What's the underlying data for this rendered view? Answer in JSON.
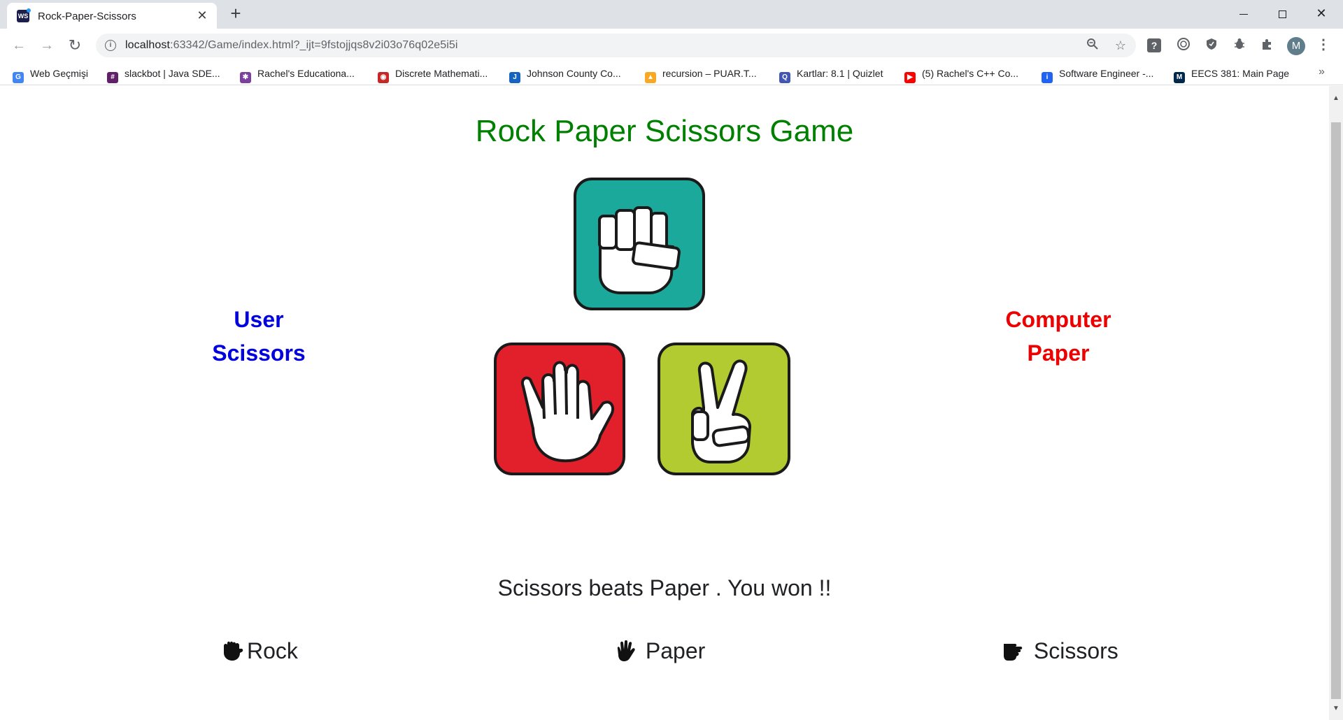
{
  "browser": {
    "tab_title": "Rock-Paper-Scissors",
    "tab_close": "✕",
    "new_tab": "+",
    "url_host": "localhost",
    "url_rest": ":63342/Game/index.html?_ijt=9fstojjqs8v2i03o76q02e5i5i",
    "avatar_letter": "M",
    "ext_help": "?",
    "bookmarks_more": "»"
  },
  "bookmarks": [
    {
      "label": "Web Geçmişi",
      "icon": "google-icon",
      "color": "#4285f4"
    },
    {
      "label": "slackbot | Java SDE...",
      "icon": "slack-icon",
      "color": "#611f69"
    },
    {
      "label": "Rachel's Educationa...",
      "icon": "gear-icon",
      "color": "#7b3fa0"
    },
    {
      "label": "Discrete Mathemati...",
      "icon": "sphere-icon",
      "color": "#c62828"
    },
    {
      "label": "Johnson County Co...",
      "icon": "jccc-icon",
      "color": "#1565c0"
    },
    {
      "label": "recursion – PUAR.T...",
      "icon": "hat-icon",
      "color": "#f9a825"
    },
    {
      "label": "Kartlar: 8.1 | Quizlet",
      "icon": "quizlet-icon",
      "color": "#4257b2"
    },
    {
      "label": "(5) Rachel's C++ Co...",
      "icon": "youtube-icon",
      "color": "#ff0000"
    },
    {
      "label": "Software Engineer -...",
      "icon": "indeed-icon",
      "color": "#2164f3"
    },
    {
      "label": "EECS 381: Main Page",
      "icon": "umich-icon",
      "color": "#00274c"
    }
  ],
  "game": {
    "title": "Rock Paper Scissors Game",
    "user_heading": "User",
    "user_choice": "Scissors",
    "computer_heading": "Computer",
    "computer_choice": "Paper",
    "result_message": "Scissors beats Paper . You won !!",
    "buttons": {
      "rock": "Rock",
      "paper": " Paper",
      "scissors": " Scissors"
    }
  },
  "colors": {
    "title": "#008000",
    "user": "#0000e0",
    "computer": "#ee0000",
    "rock_tile": "#1aa99b",
    "paper_tile": "#e2202c",
    "scissors_tile": "#b1cb30"
  }
}
